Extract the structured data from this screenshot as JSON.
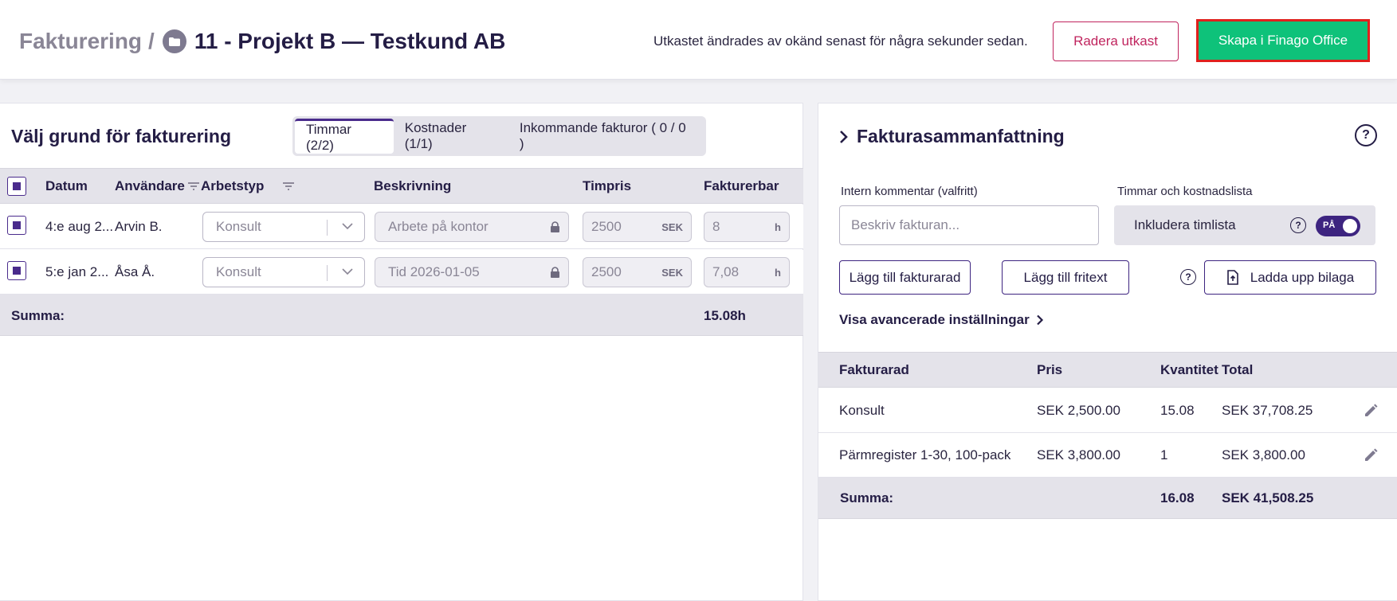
{
  "header": {
    "breadcrumb_root": "Fakturering",
    "breadcrumb_sep": "/",
    "project_title": "11 - Projekt B — Testkund AB",
    "draft_status": "Utkastet ändrades av okänd senast för några sekunder sedan.",
    "delete_label": "Radera utkast",
    "create_label": "Skapa i Finago Office"
  },
  "left": {
    "title": "Välj grund för fakturering",
    "tabs": [
      {
        "label": "Timmar (2/2)"
      },
      {
        "label": "Kostnader (1/1)"
      },
      {
        "label": "Inkommande fakturor ( 0 / 0 )"
      }
    ],
    "columns": {
      "date": "Datum",
      "user": "Användare",
      "worktype": "Arbetstyp",
      "description": "Beskrivning",
      "rate": "Timpris",
      "billable": "Fakturerbar"
    },
    "rows": [
      {
        "date": "4:e aug 2...",
        "user": "Arvin B.",
        "worktype": "Konsult",
        "description": "Arbete på kontor",
        "rate": "2500",
        "rate_unit": "SEK",
        "billable": "8",
        "billable_unit": "h"
      },
      {
        "date": "5:e jan 2...",
        "user": "Åsa Å.",
        "worktype": "Konsult",
        "description": "Tid 2026-01-05",
        "rate": "2500",
        "rate_unit": "SEK",
        "billable": "7,08",
        "billable_unit": "h"
      }
    ],
    "sum_label": "Summa:",
    "sum_value": "15.08h"
  },
  "right": {
    "title": "Fakturasammanfattning",
    "comment_label": "Intern kommentar (valfritt)",
    "comment_placeholder": "Beskriv fakturan...",
    "list_label": "Timmar och kostnadslista",
    "include_label": "Inkludera timlista",
    "toggle_text": "PÅ",
    "add_row_label": "Lägg till fakturarad",
    "add_text_label": "Lägg till fritext",
    "upload_label": "Ladda upp bilaga",
    "advanced_label": "Visa avancerade inställningar",
    "columns": {
      "row": "Fakturarad",
      "price": "Pris",
      "qty": "Kvantitet",
      "total": "Total"
    },
    "rows": [
      {
        "name": "Konsult",
        "price": "SEK 2,500.00",
        "qty": "15.08",
        "total": "SEK 37,708.25"
      },
      {
        "name": "Pärmregister 1-30, 100-pack",
        "price": "SEK 3,800.00",
        "qty": "1",
        "total": "SEK 3,800.00"
      }
    ],
    "sum_label": "Summa:",
    "sum_qty": "16.08",
    "sum_total": "SEK 41,508.25"
  }
}
